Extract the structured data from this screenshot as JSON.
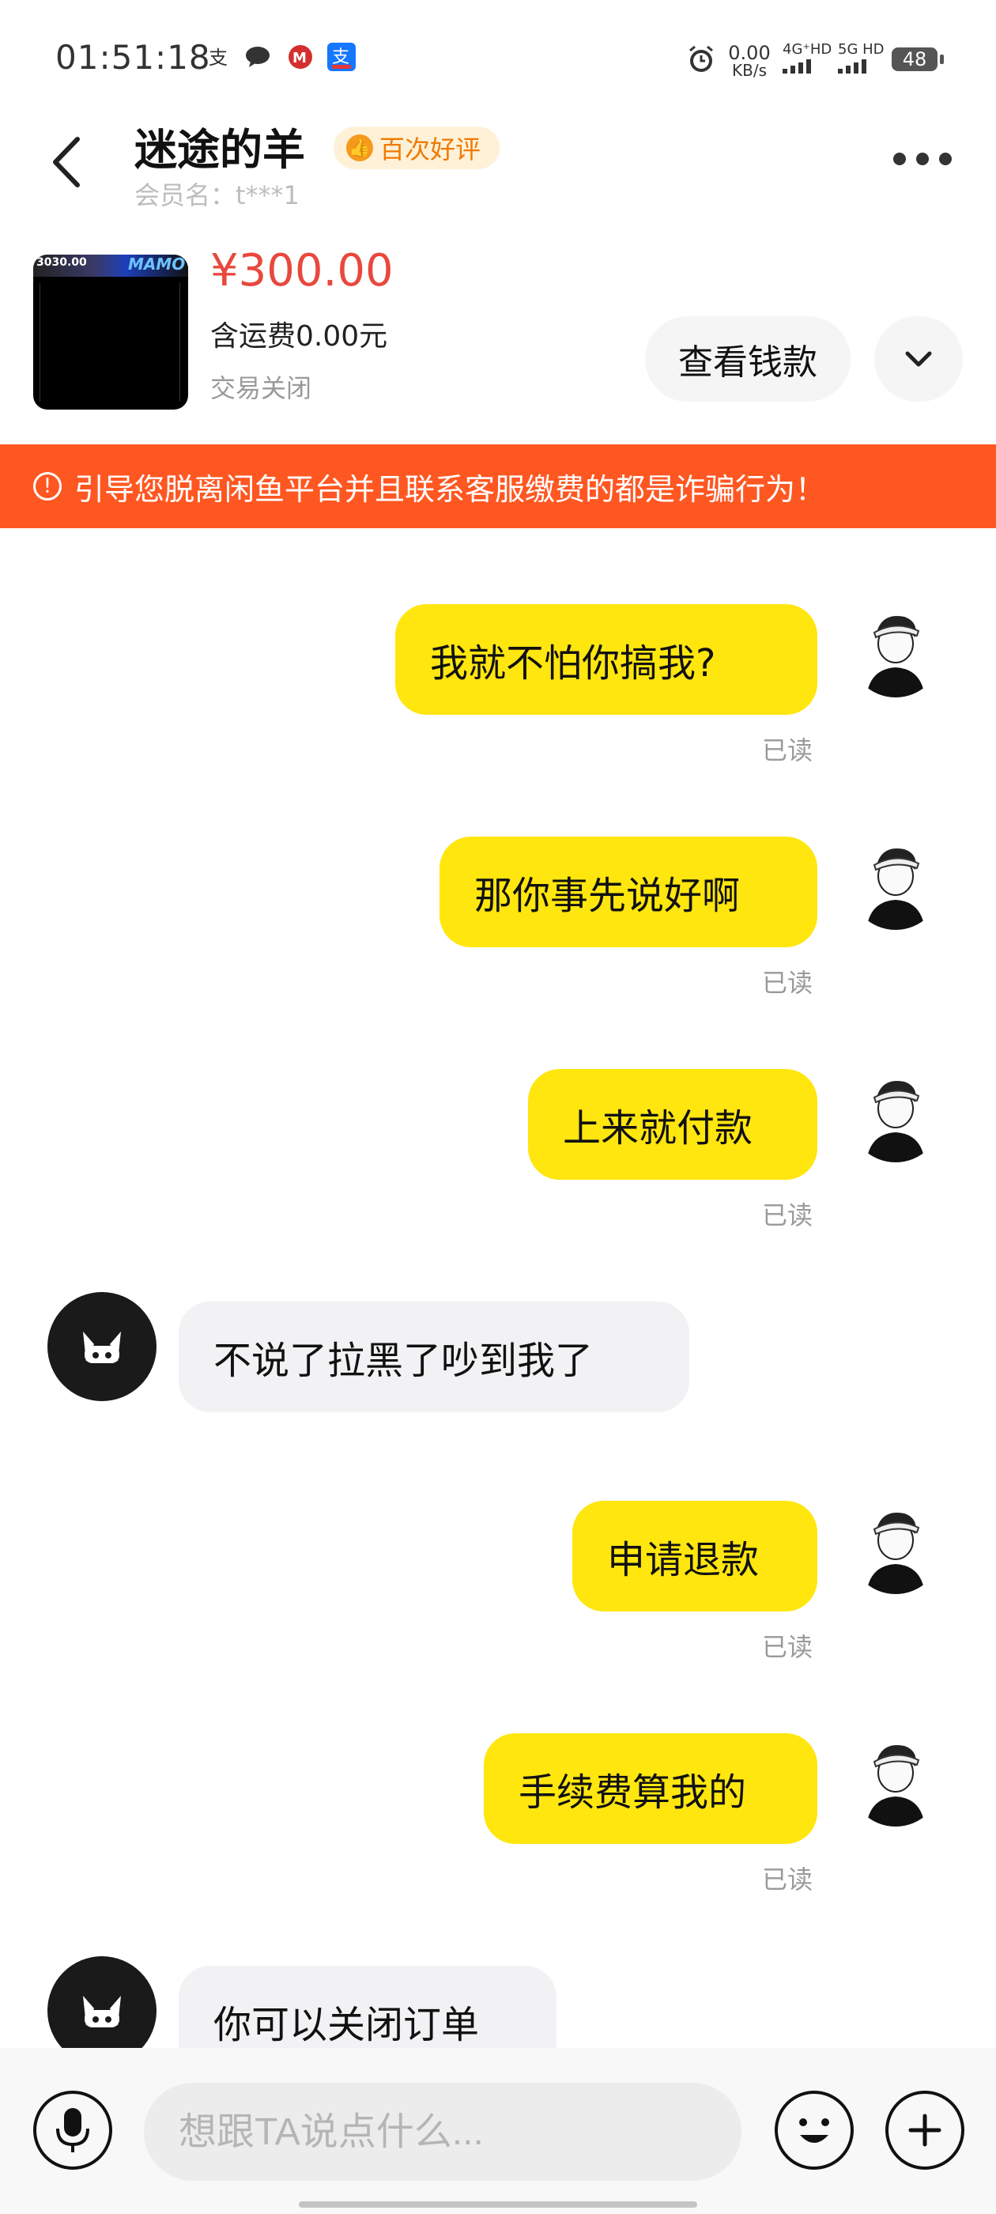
{
  "status_bar": {
    "time": "01:51:18",
    "net_speed_value": "0.00",
    "net_speed_unit": "KB/s",
    "signal1_label": "4G⁺HD",
    "signal2_label": "5G HD",
    "battery": "48"
  },
  "header": {
    "shop_name": "迷途的羊",
    "badge": "百次好评",
    "member": "会员名：t***1"
  },
  "product": {
    "price": "¥300.00",
    "shipping": "含运费0.00元",
    "status": "交易关闭",
    "view_money_label": "查看钱款",
    "thumb_text": "3030.00",
    "thumb_logo": "MAMO"
  },
  "warning": {
    "text": "引导您脱离闲鱼平台并且联系客服缴费的都是诈骗行为！"
  },
  "messages": [
    {
      "sender": "me",
      "text": "我就不怕你搞我?",
      "read": "已读"
    },
    {
      "sender": "me",
      "text": "那你事先说好啊",
      "read": "已读"
    },
    {
      "sender": "me",
      "text": "上来就付款",
      "read": "已读"
    },
    {
      "sender": "them",
      "text": "不说了拉黑了吵到我了"
    },
    {
      "sender": "me",
      "text": "申请退款",
      "read": "已读"
    },
    {
      "sender": "me",
      "text": "手续费算我的",
      "read": "已读"
    },
    {
      "sender": "them",
      "text": "你可以关闭订单"
    }
  ],
  "input": {
    "placeholder": "想跟TA说点什么..."
  },
  "colors": {
    "accent_yellow": "#ffe60f",
    "warning_orange": "#ff5722",
    "price_red": "#e8483e"
  },
  "icons": [
    "back-arrow-icon",
    "more-icon",
    "chevron-down-icon",
    "warning-icon",
    "microphone-icon",
    "emoji-icon",
    "plus-icon"
  ]
}
